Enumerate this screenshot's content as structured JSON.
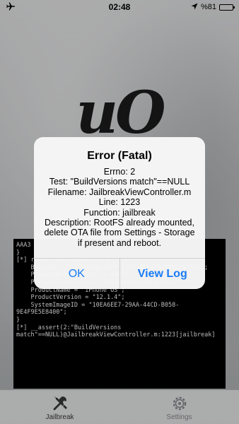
{
  "status_bar": {
    "time": "02:48",
    "battery_text": "%81",
    "battery_level": 0.81,
    "icons": [
      "airplane-icon",
      "location-arrow-icon",
      "battery-icon"
    ]
  },
  "logo": {
    "text": "uO"
  },
  "console_lines": [
    "AAA3",
    "}",
    "[*] rootfs VersionPlist: {",
    "    BuildID = \"523EBB10-28F9-11E9-ABB4-920B8C797186\";",
    "    ProductBuildVersion = 16D57;",
    "    ProductCopyright = \"1983-2019 Apple Inc.\";",
    "    ProductName = \"iPhone OS\";",
    "    ProductVersion = \"12.1.4\";",
    "    SystemImageID = \"10EA6EE7-29AA-44CD-B058-9E4F9E5E8400\";",
    "}",
    "[*] __assert(2:\"BuildVersions match\"==NULL)@JailbreakViewController.m:1223[jailbreak]"
  ],
  "alert": {
    "title": "Error (Fatal)",
    "lines": [
      "Errno: 2",
      "Test: \"BuildVersions match\"==NULL",
      "Filename: JailbreakViewController.m",
      "Line: 1223",
      "Function: jailbreak",
      "Description: RootFS already mounted, delete OTA file from Settings - Storage if present and reboot."
    ],
    "ok_label": "OK",
    "view_log_label": "View Log"
  },
  "tabs": [
    {
      "label": "Jailbreak",
      "icon": "tools-icon",
      "active": true
    },
    {
      "label": "Settings",
      "icon": "gear-icon",
      "active": false
    }
  ]
}
